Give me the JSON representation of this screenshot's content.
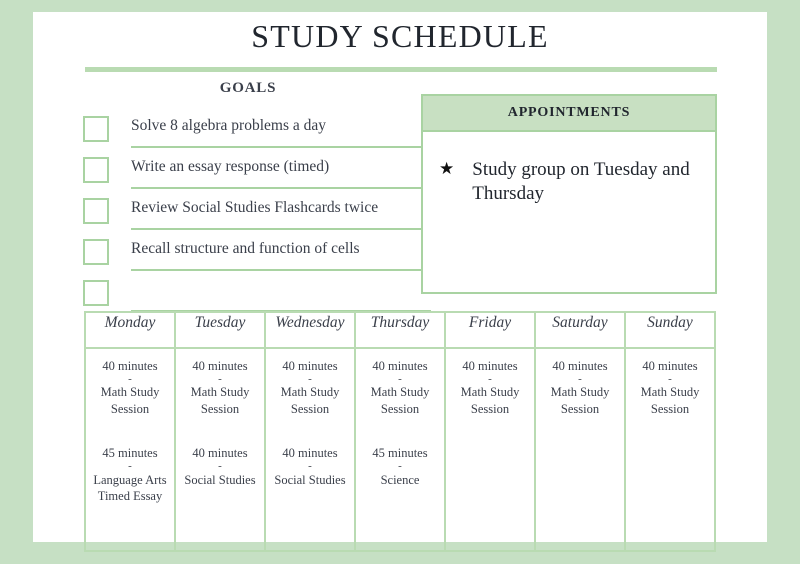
{
  "header": {
    "title": "STUDY SCHEDULE"
  },
  "goals": {
    "heading": "GOALS",
    "items": [
      {
        "text": "Solve 8 algebra problems a day",
        "checked": false
      },
      {
        "text": "Write an essay response (timed)",
        "checked": false
      },
      {
        "text": "Review Social Studies Flashcards twice",
        "checked": false
      },
      {
        "text": "Recall structure and function of cells",
        "checked": false
      },
      {
        "text": "",
        "checked": false
      }
    ]
  },
  "appointments": {
    "heading": "APPOINTMENTS",
    "bullet_icon": "star-icon",
    "bullet_glyph": "★",
    "items": [
      {
        "text": "Study group on Tuesday and Thursday"
      }
    ]
  },
  "schedule": {
    "days": [
      "Monday",
      "Tuesday",
      "Wednesday",
      "Thursday",
      "Friday",
      "Saturday",
      "Sunday"
    ],
    "separator": "-",
    "columns": [
      {
        "day": "Monday",
        "slots": [
          {
            "duration": "40 minutes",
            "activity": "Math Study Session"
          },
          {
            "duration": "45 minutes",
            "activity": "Language Arts Timed Essay"
          }
        ]
      },
      {
        "day": "Tuesday",
        "slots": [
          {
            "duration": "40 minutes",
            "activity": "Math Study Session"
          },
          {
            "duration": "40 minutes",
            "activity": "Social Studies"
          }
        ]
      },
      {
        "day": "Wednesday",
        "slots": [
          {
            "duration": "40 minutes",
            "activity": "Math Study Session"
          },
          {
            "duration": "40 minutes",
            "activity": "Social Studies"
          }
        ]
      },
      {
        "day": "Thursday",
        "slots": [
          {
            "duration": "40 minutes",
            "activity": "Math Study Session"
          },
          {
            "duration": "45 minutes",
            "activity": "Science"
          }
        ]
      },
      {
        "day": "Friday",
        "slots": [
          {
            "duration": "40 minutes",
            "activity": "Math Study Session"
          }
        ]
      },
      {
        "day": "Saturday",
        "slots": [
          {
            "duration": "40 minutes",
            "activity": "Math Study Session"
          }
        ]
      },
      {
        "day": "Sunday",
        "slots": [
          {
            "duration": "40 minutes",
            "activity": "Math Study Session"
          }
        ]
      }
    ]
  },
  "colors": {
    "frame_green": "#c6e0c4",
    "accent_green": "#b9dbb2",
    "border_green": "#a9d3a2",
    "header_fill": "#c8e0c2",
    "text_dark": "#21262e",
    "text_body": "#3a3f4a",
    "page_bg": "#ffffff"
  }
}
